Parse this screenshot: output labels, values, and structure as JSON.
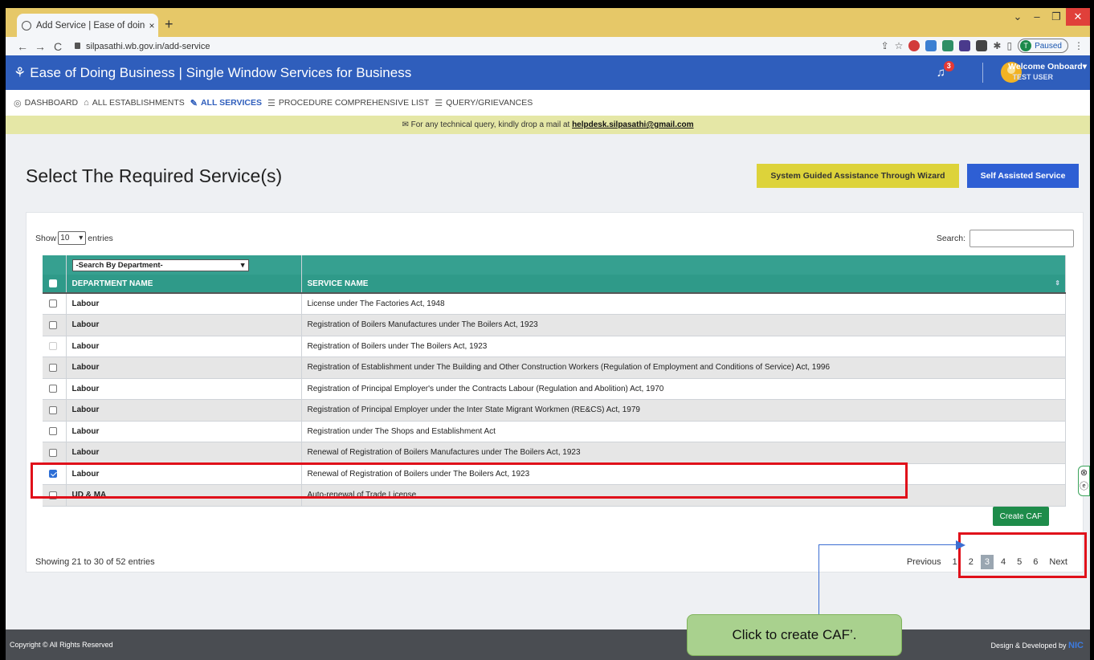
{
  "browser": {
    "tab_title": "Add Service | Ease of doing busi",
    "tab_close": "×",
    "new_tab": "+",
    "url": "silpasathi.wb.gov.in/add-service",
    "profile_label": "Paused",
    "profile_initial": "T"
  },
  "header": {
    "title": "Ease of Doing Business | Single Window Services for Business",
    "notification_count": "3",
    "welcome": "Welcome Onboard",
    "user": "TEST USER"
  },
  "nav": {
    "items": [
      {
        "label": "DASHBOARD",
        "icon": "dashboard-icon"
      },
      {
        "label": "ALL ESTABLISHMENTS",
        "icon": "building-icon"
      },
      {
        "label": "ALL SERVICES",
        "icon": "wrench-icon"
      },
      {
        "label": "PROCEDURE COMPREHENSIVE LIST",
        "icon": "list-icon"
      },
      {
        "label": "QUERY/GRIEVANCES",
        "icon": "list-icon"
      }
    ]
  },
  "notice": {
    "text": "For any technical query, kindly drop a mail at",
    "email": "helpdesk.silpasathi@gmail.com"
  },
  "page": {
    "title": "Select The Required Service(s)",
    "wizard_button": "System Guided Assistance Through Wizard",
    "self_button": "Self Assisted Service"
  },
  "table": {
    "show_label": "Show",
    "entries_label": "entries",
    "page_size": "10",
    "search_label": "Search:",
    "dept_filter_placeholder": "-Search By Department-",
    "col_department": "DEPARTMENT NAME",
    "col_service": "SERVICE NAME",
    "rows": [
      {
        "dept": "Labour",
        "service": "License under The Factories Act, 1948",
        "checked": false
      },
      {
        "dept": "Labour",
        "service": "Registration of Boilers Manufactures under The Boilers Act, 1923",
        "checked": false
      },
      {
        "dept": "Labour",
        "service": "Registration of Boilers under The Boilers Act, 1923",
        "checked": false
      },
      {
        "dept": "Labour",
        "service": "Registration of Establishment under The Building and Other Construction Workers (Regulation of Employment and Conditions of Service) Act, 1996",
        "checked": false
      },
      {
        "dept": "Labour",
        "service": "Registration of Principal Employer's under the Contracts Labour (Regulation and Abolition) Act, 1970",
        "checked": false
      },
      {
        "dept": "Labour",
        "service": "Registration of Principal Employer under the Inter State Migrant Workmen (RE&CS) Act, 1979",
        "checked": false
      },
      {
        "dept": "Labour",
        "service": "Registration under The Shops and Establishment Act",
        "checked": false
      },
      {
        "dept": "Labour",
        "service": "Renewal of Registration of Boilers Manufactures under The Boilers Act, 1923",
        "checked": false
      },
      {
        "dept": "Labour",
        "service": "Renewal of Registration of Boilers under The Boilers Act, 1923",
        "checked": true
      },
      {
        "dept": "UD & MA",
        "service": "Auto-renewal of Trade License",
        "checked": false
      }
    ],
    "showing": "Showing 21 to 30 of 52 entries",
    "pager": {
      "previous": "Previous",
      "pages": [
        "1",
        "2",
        "3",
        "4",
        "5",
        "6"
      ],
      "current": "3",
      "next": "Next"
    },
    "create_caf": "Create CAF"
  },
  "footer": {
    "copyright": "Copyright © All Rights Reserved",
    "designed_by": "Design & Developed by",
    "nic": "NIC"
  },
  "annotation": {
    "callout": "Click to create CAF’."
  },
  "colors": {
    "brand_blue": "#2f5ebc",
    "table_teal": "#2f9a89",
    "caf_green": "#1e8c4a",
    "highlight_red": "#e0101a",
    "callout_green": "#a9d18e"
  }
}
